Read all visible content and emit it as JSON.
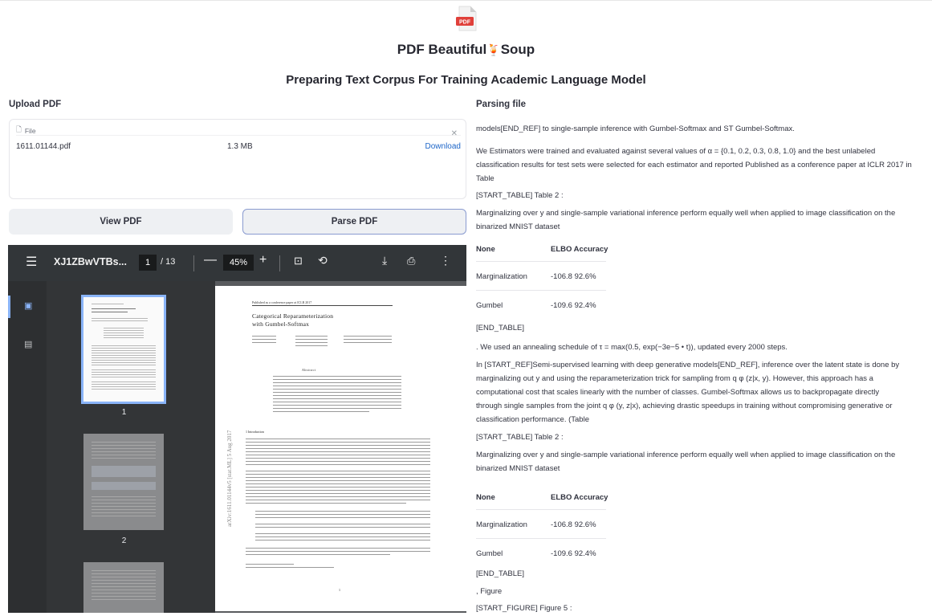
{
  "header": {
    "logo_text": "PDF",
    "app_title": "PDF Beautiful",
    "app_title_emoji": "🍹",
    "app_title_suffix": "Soup",
    "subtitle": "Preparing Text Corpus For Training Academic Language Model"
  },
  "upload": {
    "label": "Upload PDF",
    "file_tag": "File",
    "file_name": "1611.01144.pdf",
    "file_size": "1.3 MB",
    "download_label": "Download"
  },
  "buttons": {
    "view_pdf": "View PDF",
    "parse_pdf": "Parse PDF"
  },
  "viewer": {
    "doc_name": "XJ1ZBwVTBs...",
    "current_page": "1",
    "page_count": "/ 13",
    "zoom": "45%",
    "thumbnails": [
      {
        "number": "1"
      },
      {
        "number": "2"
      }
    ],
    "page": {
      "header_note": "Published as a conference paper at ICLR 2017",
      "title_line1": "Categorical Reparameterization",
      "title_line2": "with Gumbel-Softmax",
      "arxiv_stamp": "arXiv:1611.01144v5 [stat.ML] 5 Aug 2017",
      "abstract_heading": "Abstract",
      "intro_heading": "1 Introduction",
      "page_number": "1"
    }
  },
  "parsing": {
    "label": "Parsing file",
    "lines": [
      "models[END_REF] to single-sample inference with Gumbel-Softmax and ST Gumbel-Softmax.",
      "We Estimators were trained and evaluated against several values of α = {0.1, 0.2, 0.3, 0.8, 1.0} and the best unlabeled",
      "classification results for test sets were selected for each estimator and reported Published as a conference paper at ICLR 2017 in",
      "Table",
      "[START_TABLE] Table 2 :",
      "Marginalizing over y and single-sample variational inference perform equally well when applied to image classification on the",
      "binarized MNIST dataset"
    ],
    "table1": {
      "headers": [
        "None",
        "ELBO Accuracy"
      ],
      "rows": [
        [
          "Marginalization",
          "-106.8 92.6%"
        ],
        [
          "Gumbel",
          "-109.6 92.4%"
        ]
      ]
    },
    "lines2": [
      "[END_TABLE]",
      ". We used an annealing schedule of τ = max(0.5, exp(−3e−5 • t)), updated every 2000 steps.",
      "In [START_REF]Semi-supervised learning with deep generative models[END_REF], inference over the latent state is done by",
      "marginalizing out y and using the reparameterization trick for sampling from q φ (z|x, y). However, this approach has a",
      "computational cost that scales linearly with the number of classes. Gumbel-Softmax allows us to backpropagate directly",
      "through single samples from the joint q φ (y, z|x), achieving drastic speedups in training without compromising generative or",
      "classification performance. (Table",
      "[START_TABLE] Table 2 :",
      "Marginalizing over y and single-sample variational inference perform equally well when applied to image classification on the",
      "binarized MNIST dataset"
    ],
    "table2": {
      "headers": [
        "None",
        "ELBO Accuracy"
      ],
      "rows": [
        [
          "Marginalization",
          "-106.8 92.6%"
        ],
        [
          "Gumbel",
          "-109.6 92.4%"
        ]
      ]
    },
    "lines3": [
      "[END_TABLE]",
      ", Figure",
      "[START_FIGURE] Figure 5 :"
    ]
  }
}
